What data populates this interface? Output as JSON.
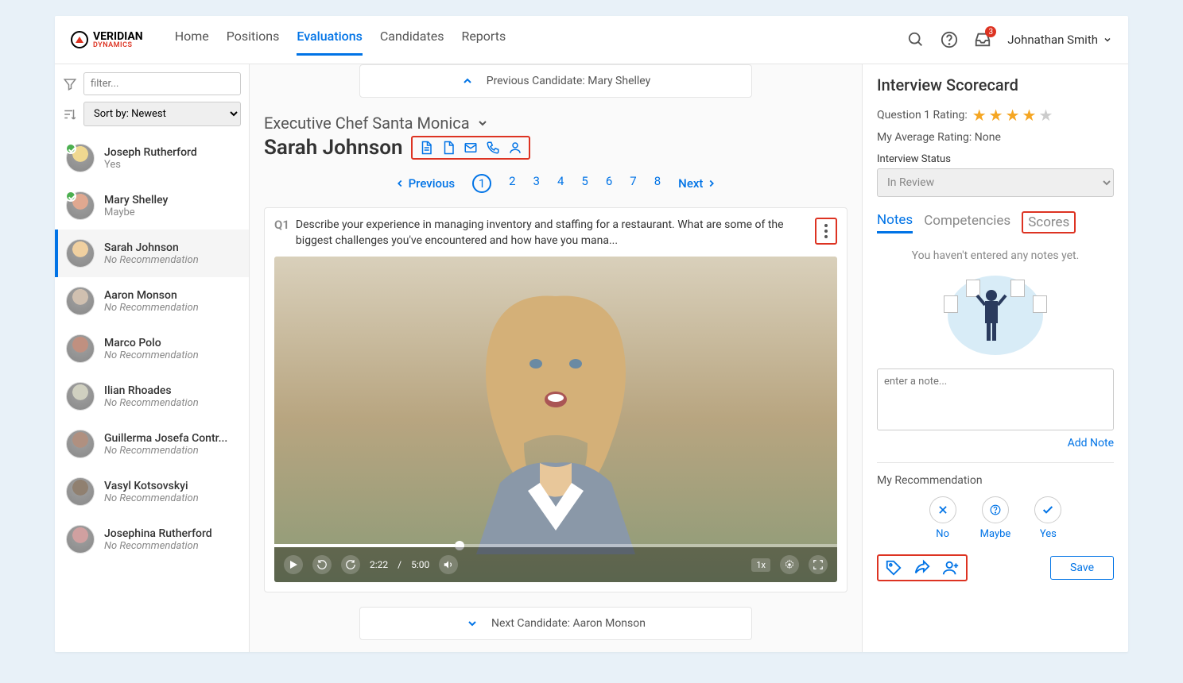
{
  "brand": {
    "name": "VERIDIAN",
    "sub": "DYNAMICS"
  },
  "nav": {
    "home": "Home",
    "positions": "Positions",
    "evaluations": "Evaluations",
    "candidates": "Candidates",
    "reports": "Reports"
  },
  "userName": "Johnathan Smith",
  "inboxBadge": "3",
  "filter": {
    "placeholder": "filter...",
    "sort": "Sort by: Newest"
  },
  "candidates": [
    {
      "name": "Joseph Rutherford",
      "sub": "Yes",
      "check": true
    },
    {
      "name": "Mary Shelley",
      "sub": "Maybe",
      "check": true
    },
    {
      "name": "Sarah Johnson",
      "sub": "No Recommendation",
      "active": true
    },
    {
      "name": "Aaron Monson",
      "sub": "No Recommendation"
    },
    {
      "name": "Marco Polo",
      "sub": "No Recommendation"
    },
    {
      "name": "Ilian Rhoades",
      "sub": "No Recommendation"
    },
    {
      "name": "Guillerma Josefa Contr...",
      "sub": "No Recommendation"
    },
    {
      "name": "Vasyl Kotsovskyi",
      "sub": "No Recommendation"
    },
    {
      "name": "Josephina Rutherford",
      "sub": "No Recommendation"
    }
  ],
  "prevCandidate": "Previous Candidate: Mary Shelley",
  "nextCandidate": "Next Candidate: Aaron Monson",
  "positionTitle": "Executive Chef Santa Monica",
  "candidateName": "Sarah Johnson",
  "pager": {
    "prev": "Previous",
    "next": "Next",
    "pages": [
      "1",
      "2",
      "3",
      "4",
      "5",
      "6",
      "7",
      "8"
    ]
  },
  "question": {
    "num": "Q1",
    "text": "Describe your experience in managing inventory and staffing for a restaurant. What are some of the biggest challenges you've encountered and how have you mana..."
  },
  "video": {
    "elapsed": "2:22",
    "total": "5:00",
    "speed": "1x"
  },
  "scorecard": {
    "title": "Interview Scorecard",
    "q1label": "Question 1 Rating:",
    "stars": 4,
    "avgLabel": "My Average Rating: None",
    "statusLabel": "Interview Status",
    "statusValue": "In Review",
    "tabs": {
      "notes": "Notes",
      "comp": "Competencies",
      "scores": "Scores"
    },
    "emptyNotes": "You haven't entered any notes yet.",
    "notePlaceholder": "enter a note...",
    "addNote": "Add Note",
    "recTitle": "My Recommendation",
    "rec": {
      "no": "No",
      "maybe": "Maybe",
      "yes": "Yes"
    },
    "save": "Save"
  }
}
